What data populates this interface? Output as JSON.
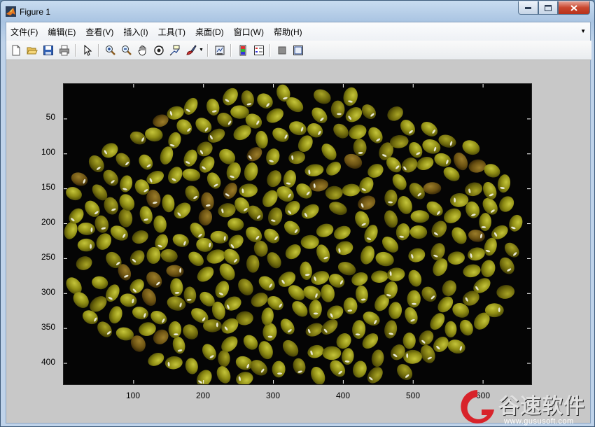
{
  "window": {
    "title": "Figure 1"
  },
  "menu": {
    "items": [
      "文件(F)",
      "编辑(E)",
      "查看(V)",
      "插入(I)",
      "工具(T)",
      "桌面(D)",
      "窗口(W)",
      "帮助(H)"
    ]
  },
  "toolbar": {
    "buttons": [
      "new-figure-icon",
      "open-file-icon",
      "save-icon",
      "print-icon",
      "edit-plot-arrow-icon",
      "zoom-in-icon",
      "zoom-out-icon",
      "pan-hand-icon",
      "rotate-3d-icon",
      "data-cursor-icon",
      "brush-icon",
      "link-plot-icon",
      "colorbar-icon",
      "legend-icon",
      "hide-plot-tools-icon",
      "show-plot-tools-icon"
    ]
  },
  "plot": {
    "x_ticks": [
      "100",
      "200",
      "300",
      "400",
      "500",
      "600"
    ],
    "y_ticks": [
      "50",
      "100",
      "150",
      "200",
      "250",
      "300",
      "350",
      "400"
    ],
    "image_desc": "mung beans on black background",
    "bean_color": "#8a8a12"
  },
  "watermark": {
    "text": "谷速软件",
    "url": "www.gususoft.com"
  },
  "colors": {
    "close_button": "#c9462e",
    "figure_bg": "#c8c8c8",
    "axes_bg": "#050505"
  }
}
